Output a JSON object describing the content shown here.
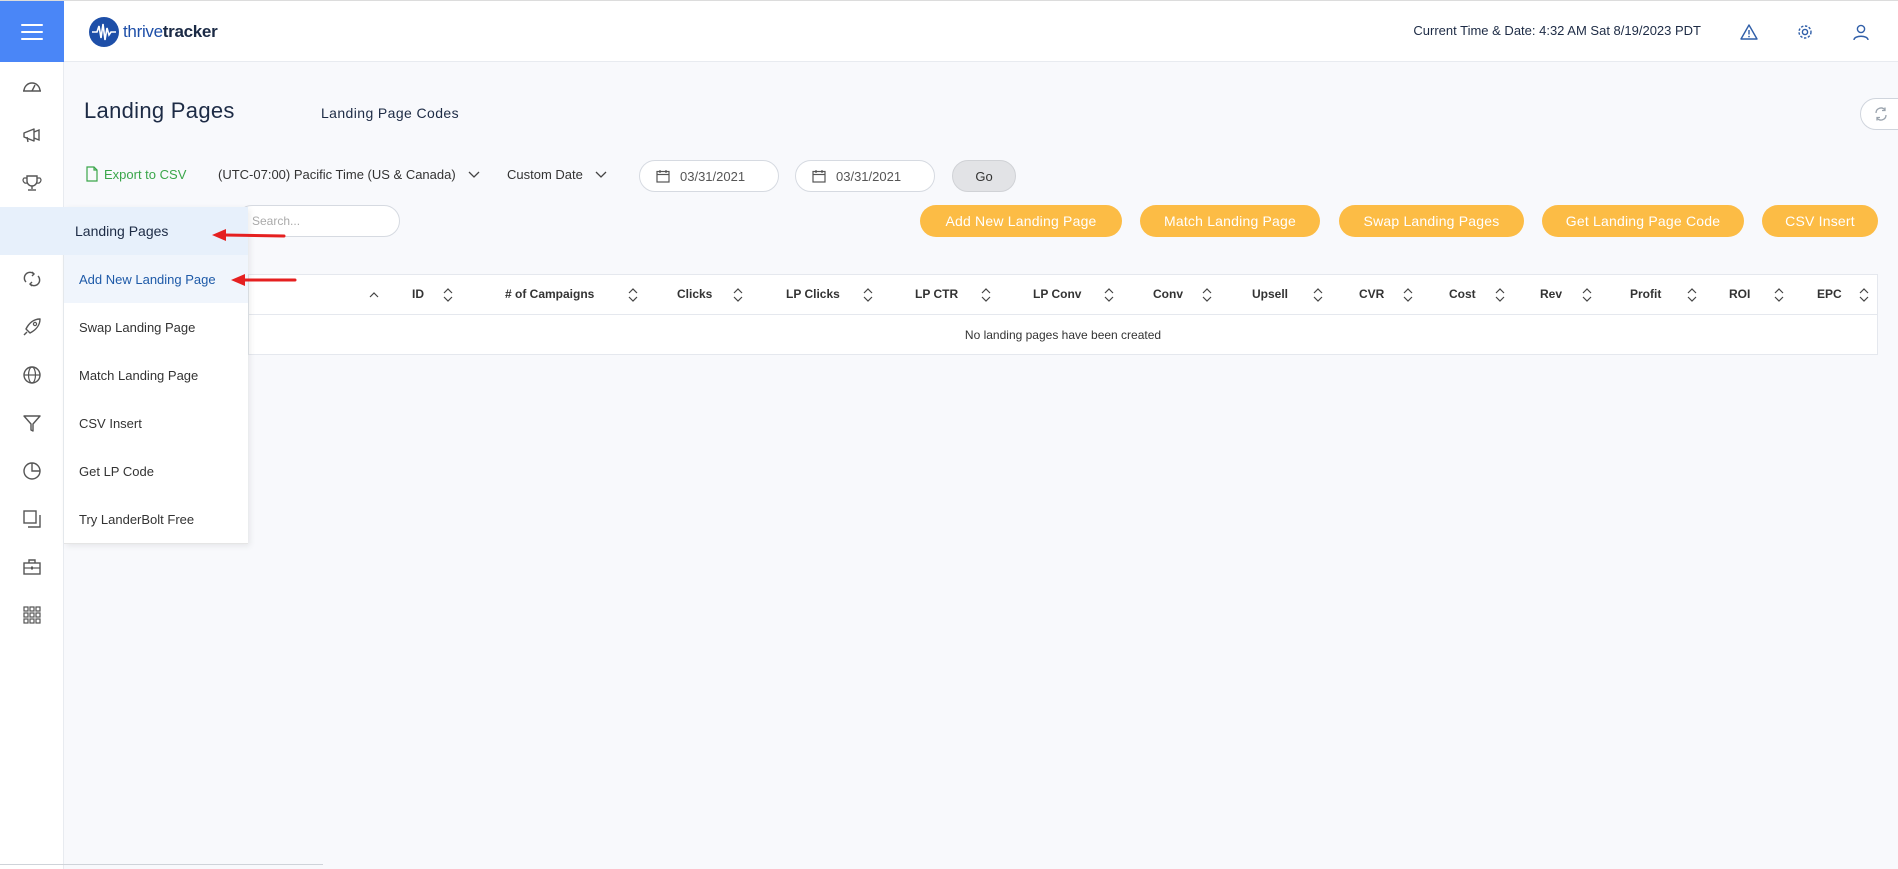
{
  "header": {
    "logo_text_a": "thrive",
    "logo_text_b": "tracker",
    "clock": "Current Time & Date: 4:32 AM Sat 8/19/2023 PDT",
    "icons": [
      "warning-icon",
      "gear-icon",
      "user-icon"
    ]
  },
  "rail": {
    "icons": [
      "dashboard-icon",
      "megaphone-icon",
      "trophy-icon",
      "location-pin-icon",
      "swap-icon",
      "rocket-icon",
      "globe-icon",
      "funnel-icon",
      "pie-chart-icon",
      "copy-icon",
      "briefcase-icon",
      "apps-grid-icon"
    ]
  },
  "flyout": {
    "title": "Landing Pages",
    "items": [
      "Add New Landing Page",
      "Swap Landing Page",
      "Match Landing Page",
      "CSV Insert",
      "Get LP Code",
      "Try LanderBolt Free"
    ]
  },
  "page": {
    "title": "Landing Pages",
    "sub_tab": "Landing Page Codes"
  },
  "filters": {
    "export_label": "Export to CSV",
    "timezone": "(UTC-07:00) Pacific Time (US & Canada)",
    "date_mode": "Custom Date",
    "date_from": "03/31/2021",
    "date_to": "03/31/2021",
    "go_label": "Go"
  },
  "search": {
    "placeholder": "Search..."
  },
  "actions": [
    "Add New Landing Page",
    "Match Landing Page",
    "Swap Landing Pages",
    "Get Landing Page Code",
    "CSV Insert"
  ],
  "table": {
    "columns": [
      "ID",
      "# of Campaigns",
      "Clicks",
      "LP Clicks",
      "LP CTR",
      "LP Conv",
      "Conv",
      "Upsell",
      "CVR",
      "Cost",
      "Rev",
      "Profit",
      "ROI",
      "EPC"
    ],
    "empty_message": "No landing pages have been created"
  },
  "colors": {
    "accent": "#4a86f7",
    "action_button": "#fcbc45",
    "export_green": "#3aa64a",
    "annotation_red": "#e52020"
  }
}
